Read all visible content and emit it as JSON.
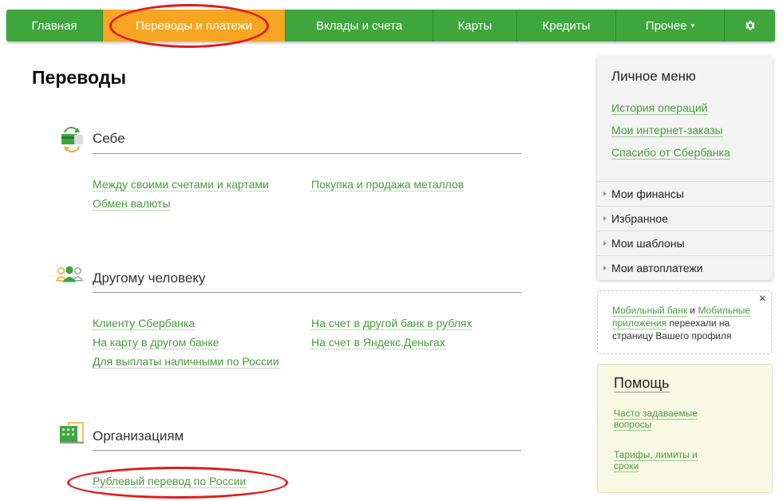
{
  "nav": {
    "items": [
      {
        "label": "Главная"
      },
      {
        "label": "Переводы и платежи"
      },
      {
        "label": "Вклады и счета"
      },
      {
        "label": "Карты"
      },
      {
        "label": "Кредиты"
      },
      {
        "label": "Прочее"
      }
    ],
    "caret": "▾",
    "accent": "#3fa63e",
    "active_color": "#f6a623"
  },
  "page": {
    "title": "Переводы"
  },
  "sections": [
    {
      "title": "Себе",
      "icon": "card-exchange-icon",
      "links": [
        "Между своими счетами и картами",
        "Обмен валюты",
        "Покупка и продажа металлов"
      ]
    },
    {
      "title": "Другому человеку",
      "icon": "people-icon",
      "links": [
        "Клиенту Сбербанка",
        "На карту в другом банке",
        "Для выплаты наличными по России",
        "На счет в другой банк в рублях",
        "На счет в Яндекс.Деньгах"
      ]
    },
    {
      "title": "Организациям",
      "icon": "building-icon",
      "links": [
        "Рублевый перевод по России"
      ]
    }
  ],
  "sidebar": {
    "title": "Личное меню",
    "links": [
      "История операций",
      "Мои интернет-заказы",
      "Спасибо от Сбербанка"
    ],
    "rows": [
      "Мои финансы",
      "Избранное",
      "Мои шаблоны",
      "Мои автоплатежи"
    ]
  },
  "notice": {
    "link1": "Мобильный банк",
    "and": " и ",
    "link2": "Мобильные приложения",
    "rest": " переехали на страницу Вашего профиля",
    "close": "×"
  },
  "help": {
    "title": "Помощь",
    "links": [
      "Часто задаваемые вопросы",
      "Тарифы, лимиты и сроки"
    ]
  }
}
